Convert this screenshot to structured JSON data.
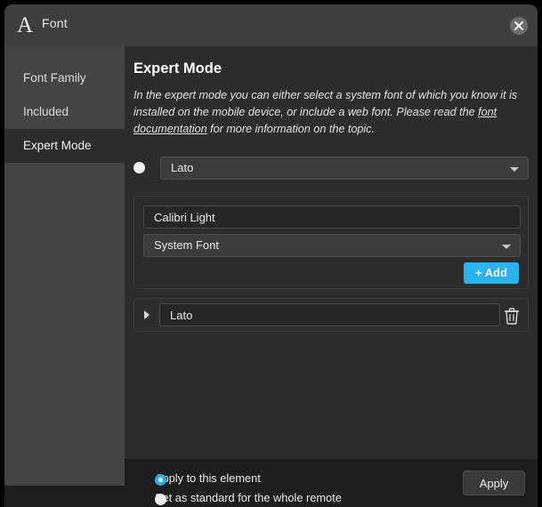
{
  "window": {
    "title": "Font",
    "icon": "font-A-icon",
    "close_label": "close-icon"
  },
  "sidebar": {
    "items": [
      {
        "label": "Font Family",
        "selected": false
      },
      {
        "label": "Included",
        "selected": false
      },
      {
        "label": "Expert Mode",
        "selected": true
      }
    ]
  },
  "main": {
    "title": "Expert Mode",
    "description_part1": "In the expert mode you can either select a system font of which you know it is installed on the mobile device, or include a web font. Please read the ",
    "description_link": "font documentation",
    "description_part2": " for more information on the topic.",
    "system_font_select": {
      "value": "Lato",
      "radio_selected": false
    },
    "add_panel": {
      "font_name_value": "Calibri Light",
      "font_name_placeholder": "Calibri Light",
      "type_select_value": "System Font",
      "add_button_label": "Add",
      "add_button_icon": "plus-icon",
      "add_button_color": "#29b3f0"
    },
    "font_list": [
      {
        "expander_icon": "chevron-right-icon",
        "value": "Lato",
        "delete_icon": "trash-icon"
      }
    ]
  },
  "footer": {
    "options": [
      {
        "label": "Apply to this element",
        "selected": true
      },
      {
        "label": "Set as standard for the whole remote",
        "selected": false
      }
    ],
    "apply_label": "Apply",
    "accent_color": "#29abe6"
  }
}
